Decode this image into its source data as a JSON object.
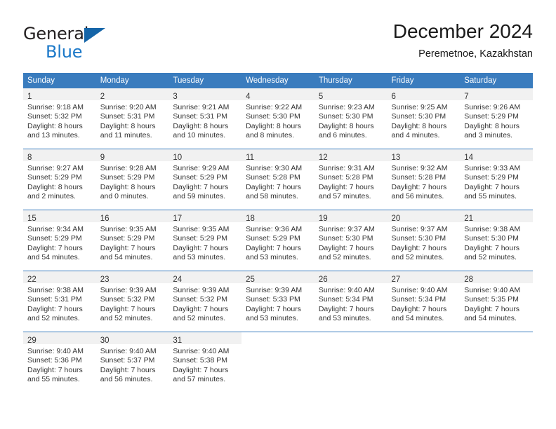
{
  "logo": {
    "word_top": "General",
    "word_bottom": "Blue",
    "triangle_color": "#1565a8",
    "blue_color": "#1b78c8"
  },
  "header": {
    "title": "December 2024",
    "subtitle": "Peremetnoe, Kazakhstan"
  },
  "theme": {
    "header_bg": "#3a7cbe",
    "header_text": "#ffffff",
    "daynum_band_bg": "#f1f1f1",
    "body_text": "#333333",
    "week_rule": "#3a7cbe"
  },
  "weekday_headers": [
    "Sunday",
    "Monday",
    "Tuesday",
    "Wednesday",
    "Thursday",
    "Friday",
    "Saturday"
  ],
  "weeks": [
    [
      {
        "day": "1",
        "sunrise": "Sunrise: 9:18 AM",
        "sunset": "Sunset: 5:32 PM",
        "daylight1": "Daylight: 8 hours",
        "daylight2": "and 13 minutes."
      },
      {
        "day": "2",
        "sunrise": "Sunrise: 9:20 AM",
        "sunset": "Sunset: 5:31 PM",
        "daylight1": "Daylight: 8 hours",
        "daylight2": "and 11 minutes."
      },
      {
        "day": "3",
        "sunrise": "Sunrise: 9:21 AM",
        "sunset": "Sunset: 5:31 PM",
        "daylight1": "Daylight: 8 hours",
        "daylight2": "and 10 minutes."
      },
      {
        "day": "4",
        "sunrise": "Sunrise: 9:22 AM",
        "sunset": "Sunset: 5:30 PM",
        "daylight1": "Daylight: 8 hours",
        "daylight2": "and 8 minutes."
      },
      {
        "day": "5",
        "sunrise": "Sunrise: 9:23 AM",
        "sunset": "Sunset: 5:30 PM",
        "daylight1": "Daylight: 8 hours",
        "daylight2": "and 6 minutes."
      },
      {
        "day": "6",
        "sunrise": "Sunrise: 9:25 AM",
        "sunset": "Sunset: 5:30 PM",
        "daylight1": "Daylight: 8 hours",
        "daylight2": "and 4 minutes."
      },
      {
        "day": "7",
        "sunrise": "Sunrise: 9:26 AM",
        "sunset": "Sunset: 5:29 PM",
        "daylight1": "Daylight: 8 hours",
        "daylight2": "and 3 minutes."
      }
    ],
    [
      {
        "day": "8",
        "sunrise": "Sunrise: 9:27 AM",
        "sunset": "Sunset: 5:29 PM",
        "daylight1": "Daylight: 8 hours",
        "daylight2": "and 2 minutes."
      },
      {
        "day": "9",
        "sunrise": "Sunrise: 9:28 AM",
        "sunset": "Sunset: 5:29 PM",
        "daylight1": "Daylight: 8 hours",
        "daylight2": "and 0 minutes."
      },
      {
        "day": "10",
        "sunrise": "Sunrise: 9:29 AM",
        "sunset": "Sunset: 5:29 PM",
        "daylight1": "Daylight: 7 hours",
        "daylight2": "and 59 minutes."
      },
      {
        "day": "11",
        "sunrise": "Sunrise: 9:30 AM",
        "sunset": "Sunset: 5:28 PM",
        "daylight1": "Daylight: 7 hours",
        "daylight2": "and 58 minutes."
      },
      {
        "day": "12",
        "sunrise": "Sunrise: 9:31 AM",
        "sunset": "Sunset: 5:28 PM",
        "daylight1": "Daylight: 7 hours",
        "daylight2": "and 57 minutes."
      },
      {
        "day": "13",
        "sunrise": "Sunrise: 9:32 AM",
        "sunset": "Sunset: 5:28 PM",
        "daylight1": "Daylight: 7 hours",
        "daylight2": "and 56 minutes."
      },
      {
        "day": "14",
        "sunrise": "Sunrise: 9:33 AM",
        "sunset": "Sunset: 5:29 PM",
        "daylight1": "Daylight: 7 hours",
        "daylight2": "and 55 minutes."
      }
    ],
    [
      {
        "day": "15",
        "sunrise": "Sunrise: 9:34 AM",
        "sunset": "Sunset: 5:29 PM",
        "daylight1": "Daylight: 7 hours",
        "daylight2": "and 54 minutes."
      },
      {
        "day": "16",
        "sunrise": "Sunrise: 9:35 AM",
        "sunset": "Sunset: 5:29 PM",
        "daylight1": "Daylight: 7 hours",
        "daylight2": "and 54 minutes."
      },
      {
        "day": "17",
        "sunrise": "Sunrise: 9:35 AM",
        "sunset": "Sunset: 5:29 PM",
        "daylight1": "Daylight: 7 hours",
        "daylight2": "and 53 minutes."
      },
      {
        "day": "18",
        "sunrise": "Sunrise: 9:36 AM",
        "sunset": "Sunset: 5:29 PM",
        "daylight1": "Daylight: 7 hours",
        "daylight2": "and 53 minutes."
      },
      {
        "day": "19",
        "sunrise": "Sunrise: 9:37 AM",
        "sunset": "Sunset: 5:30 PM",
        "daylight1": "Daylight: 7 hours",
        "daylight2": "and 52 minutes."
      },
      {
        "day": "20",
        "sunrise": "Sunrise: 9:37 AM",
        "sunset": "Sunset: 5:30 PM",
        "daylight1": "Daylight: 7 hours",
        "daylight2": "and 52 minutes."
      },
      {
        "day": "21",
        "sunrise": "Sunrise: 9:38 AM",
        "sunset": "Sunset: 5:30 PM",
        "daylight1": "Daylight: 7 hours",
        "daylight2": "and 52 minutes."
      }
    ],
    [
      {
        "day": "22",
        "sunrise": "Sunrise: 9:38 AM",
        "sunset": "Sunset: 5:31 PM",
        "daylight1": "Daylight: 7 hours",
        "daylight2": "and 52 minutes."
      },
      {
        "day": "23",
        "sunrise": "Sunrise: 9:39 AM",
        "sunset": "Sunset: 5:32 PM",
        "daylight1": "Daylight: 7 hours",
        "daylight2": "and 52 minutes."
      },
      {
        "day": "24",
        "sunrise": "Sunrise: 9:39 AM",
        "sunset": "Sunset: 5:32 PM",
        "daylight1": "Daylight: 7 hours",
        "daylight2": "and 52 minutes."
      },
      {
        "day": "25",
        "sunrise": "Sunrise: 9:39 AM",
        "sunset": "Sunset: 5:33 PM",
        "daylight1": "Daylight: 7 hours",
        "daylight2": "and 53 minutes."
      },
      {
        "day": "26",
        "sunrise": "Sunrise: 9:40 AM",
        "sunset": "Sunset: 5:34 PM",
        "daylight1": "Daylight: 7 hours",
        "daylight2": "and 53 minutes."
      },
      {
        "day": "27",
        "sunrise": "Sunrise: 9:40 AM",
        "sunset": "Sunset: 5:34 PM",
        "daylight1": "Daylight: 7 hours",
        "daylight2": "and 54 minutes."
      },
      {
        "day": "28",
        "sunrise": "Sunrise: 9:40 AM",
        "sunset": "Sunset: 5:35 PM",
        "daylight1": "Daylight: 7 hours",
        "daylight2": "and 54 minutes."
      }
    ],
    [
      {
        "day": "29",
        "sunrise": "Sunrise: 9:40 AM",
        "sunset": "Sunset: 5:36 PM",
        "daylight1": "Daylight: 7 hours",
        "daylight2": "and 55 minutes."
      },
      {
        "day": "30",
        "sunrise": "Sunrise: 9:40 AM",
        "sunset": "Sunset: 5:37 PM",
        "daylight1": "Daylight: 7 hours",
        "daylight2": "and 56 minutes."
      },
      {
        "day": "31",
        "sunrise": "Sunrise: 9:40 AM",
        "sunset": "Sunset: 5:38 PM",
        "daylight1": "Daylight: 7 hours",
        "daylight2": "and 57 minutes."
      },
      {
        "day": "",
        "sunrise": "",
        "sunset": "",
        "daylight1": "",
        "daylight2": ""
      },
      {
        "day": "",
        "sunrise": "",
        "sunset": "",
        "daylight1": "",
        "daylight2": ""
      },
      {
        "day": "",
        "sunrise": "",
        "sunset": "",
        "daylight1": "",
        "daylight2": ""
      },
      {
        "day": "",
        "sunrise": "",
        "sunset": "",
        "daylight1": "",
        "daylight2": ""
      }
    ]
  ]
}
